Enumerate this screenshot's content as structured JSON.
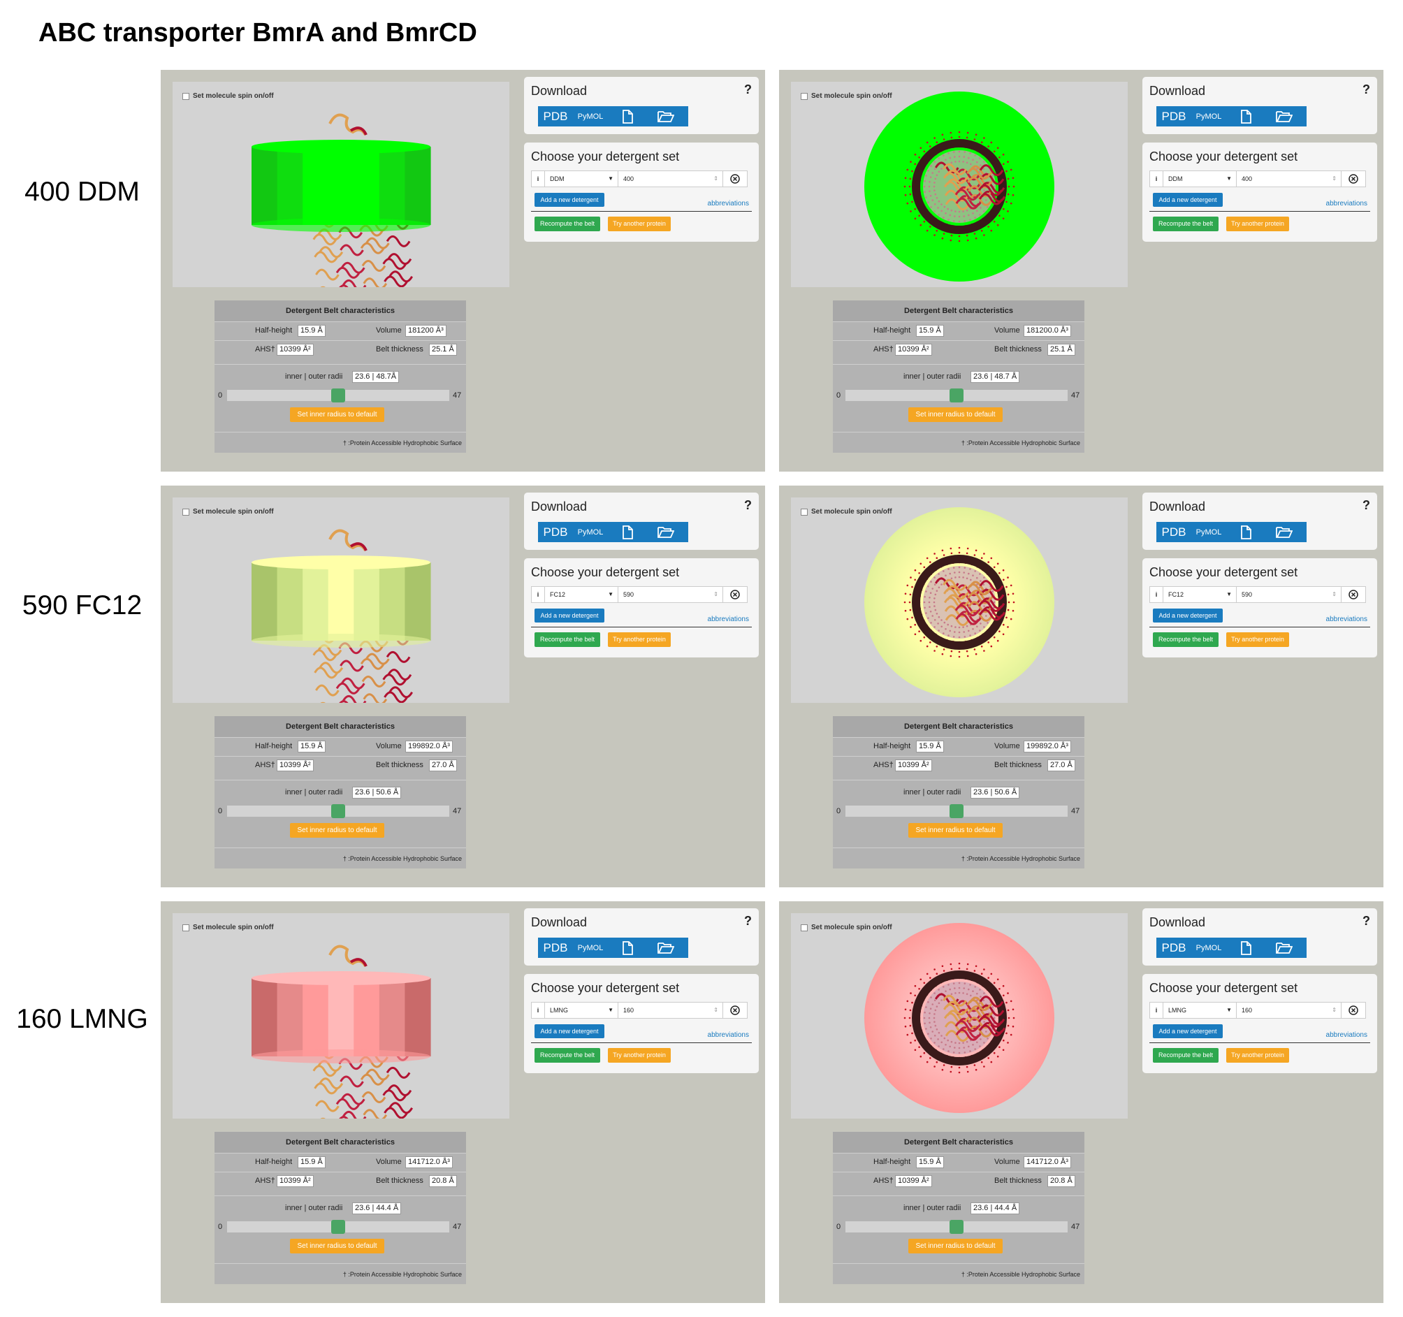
{
  "figure_title": "ABC transporter BmrA and BmrCD",
  "ui_labels": {
    "spin_toggle": "Set molecule spin on/off",
    "download_title": "Download",
    "help": "?",
    "pdb_button": "PDB",
    "pymol_button": "PyMOL",
    "detergent_title": "Choose your detergent set",
    "info_button": "i",
    "add_detergent": "Add a new detergent",
    "abbreviations": "abbreviations",
    "recompute": "Recompute the belt",
    "try_another": "Try another protein",
    "char_title": "Detergent Belt characteristics",
    "half_height_label": "Half-height",
    "volume_label": "Volume",
    "ahs_label": "AHS†",
    "thickness_label": "Belt thickness",
    "radii_label": "inner | outer radii",
    "slider_min": "0",
    "slider_max": "47",
    "reset_radius": "Set inner radius to default",
    "footnote": "† :Protein Accessible Hydrophobic Surface"
  },
  "icons": [
    "file-icon",
    "folder-open-icon",
    "clear-circle-icon",
    "caret-down-icon"
  ],
  "rows": [
    {
      "label": "400 DDM",
      "detergent": "DDM",
      "count": "400",
      "belt_color": "#00ff00",
      "belt_shades": [
        "#12c812",
        "#0fdd0f",
        "#00ff00",
        "#00ff00",
        "#00ff00",
        "#0fdd0f",
        "#12c812"
      ],
      "slider_fraction": 0.5,
      "panels": [
        {
          "half_height": "15.9 Å",
          "volume": "181200 Å³",
          "ahs": "10399 Å²",
          "thickness": "25.1 Å",
          "radii": "23.6 | 48.7Å"
        },
        {
          "half_height": "15.9 Å",
          "volume": "181200.0 Å³",
          "ahs": "10399 Å²",
          "thickness": "25.1 Å",
          "radii": "23.6 | 48.7 Å"
        }
      ]
    },
    {
      "label": "590 FC12",
      "detergent": "FC12",
      "count": "590",
      "belt_color": "#ffffa8",
      "belt_shades": [
        "#a9c46a",
        "#c7de82",
        "#e2f29a",
        "#ffffa8",
        "#e2f29a",
        "#c7de82",
        "#a9c46a"
      ],
      "slider_fraction": 0.5,
      "panels": [
        {
          "half_height": "15.9 Å",
          "volume": "199892.0 Å³",
          "ahs": "10399 Å²",
          "thickness": "27.0 Å",
          "radii": "23.6 | 50.6 Å"
        },
        {
          "half_height": "15.9 Å",
          "volume": "199892.0 Å³",
          "ahs": "10399 Å²",
          "thickness": "27.0 Å",
          "radii": "23.6 | 50.6 Å"
        }
      ]
    },
    {
      "label": "160 LMNG",
      "detergent": "LMNG",
      "count": "160",
      "belt_color": "#ffb8b8",
      "belt_shades": [
        "#c96a6a",
        "#e58a8a",
        "#ff9a9a",
        "#ffb8b8",
        "#ff9a9a",
        "#e58a8a",
        "#c96a6a"
      ],
      "slider_fraction": 0.5,
      "panels": [
        {
          "half_height": "15.9 Å",
          "volume": "141712.0 Å³",
          "ahs": "10399 Å²",
          "thickness": "20.8 Å",
          "radii": "23.6 | 44.4 Å"
        },
        {
          "half_height": "15.9 Å",
          "volume": "141712.0 Å³",
          "ahs": "10399 Å²",
          "thickness": "20.8 Å",
          "radii": "23.6 | 44.4 Å"
        }
      ]
    }
  ]
}
